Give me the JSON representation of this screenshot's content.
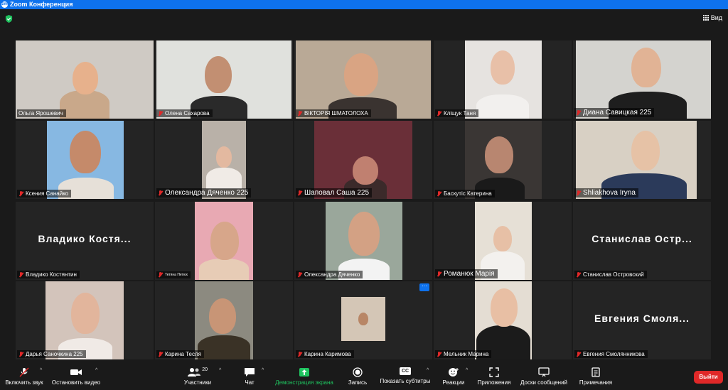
{
  "window": {
    "title": "Zoom Конференция",
    "logo": "zm"
  },
  "topbar": {
    "view_label": "Вид"
  },
  "participants": [
    {
      "name": "Ольга Ярошевич"
    },
    {
      "name": "Олена Сахарова"
    },
    {
      "name": "ВІКТОРІЯ ШМАТОЛОХА"
    },
    {
      "name": "Кліщук Таня"
    },
    {
      "name": "Диана Савицкая 225"
    },
    {
      "name": "Ксения Санайко"
    },
    {
      "name": "Олександра Дяченко 225"
    },
    {
      "name": "Шаповал Саша 225"
    },
    {
      "name": "Баскутіс Катерина"
    },
    {
      "name": "Shliakhova Iryna"
    },
    {
      "name": "Владико Костянтин",
      "display": "Владико Костя..."
    },
    {
      "name": "Тетяна Петюх"
    },
    {
      "name": "Олександра Дяченко"
    },
    {
      "name": "Романюк Марія"
    },
    {
      "name": "Станислав Островский",
      "display": "Станислав Остр..."
    },
    {
      "name": "Дарья Саночкина 225"
    },
    {
      "name": "Карина Тесля"
    },
    {
      "name": "Карина Каримова"
    },
    {
      "name": "Мельник Марина"
    },
    {
      "name": "Евгения Смолянникова",
      "display": "Евгения Смоля..."
    }
  ],
  "toolbar": {
    "mute": "Включить звук",
    "video": "Остановить видео",
    "participants": "Участники",
    "participants_count": "20",
    "chat": "Чат",
    "share": "Демонстрация экрана",
    "record": "Запись",
    "subtitles": "Показать субтитры",
    "subtitles_icon_text": "CC",
    "reactions": "Реакции",
    "apps": "Приложения",
    "whiteboards": "Доски сообщений",
    "notes": "Примечания",
    "leave": "Выйти"
  },
  "colors": {
    "accent": "#0e72ed",
    "active_speaker": "#c9e26a",
    "share_green": "#1fc35f",
    "leave_red": "#e02828"
  }
}
